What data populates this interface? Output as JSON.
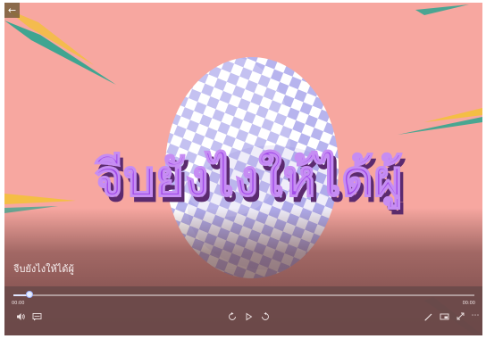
{
  "player": {
    "title_overlay": "จีบยังไงให้ได้ผู้",
    "video_title": "จีบยังไงให้ได้ผู้",
    "progress": 0.035,
    "current_time": "00:00",
    "total_time": "00:00"
  },
  "icons": {
    "back": "back-arrow-icon",
    "volume": "speaker-icon",
    "captions": "captions-icon",
    "rewind": "rewind-10-icon",
    "play": "play-icon",
    "forward": "forward-30-icon",
    "edit": "pencil-icon",
    "miniplayer": "mini-view-icon",
    "fullscreen": "fullscreen-icon",
    "more": "more-icon"
  },
  "colors": {
    "background": "#f7a7a0",
    "title_fill": "#a24be8",
    "title_shadow": "#5b2a6f",
    "checker": "#b7b4ee",
    "seek_fill": "#dfe6ff"
  }
}
